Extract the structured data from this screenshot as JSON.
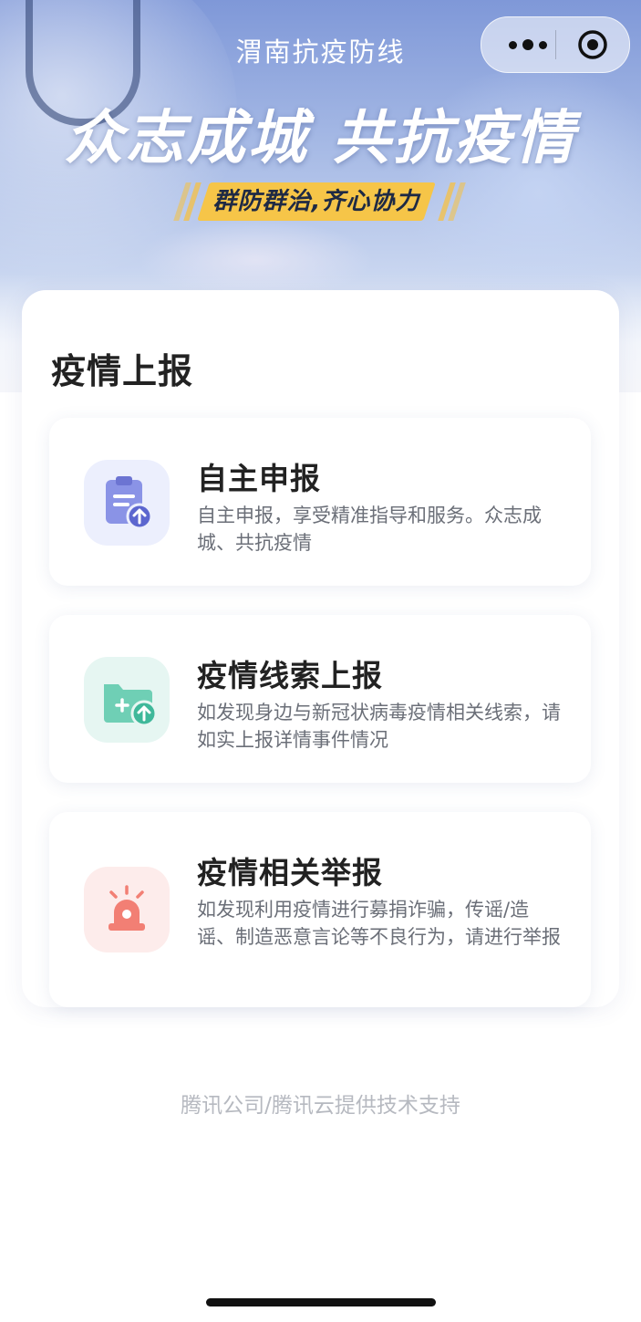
{
  "nav": {
    "title": "渭南抗疫防线"
  },
  "hero": {
    "slogan": "众志成城 共抗疫情",
    "banner": "群防群治,齐心协力"
  },
  "section": {
    "title": "疫情上报"
  },
  "items": [
    {
      "title": "自主申报",
      "desc": "自主申报，享受精准指导和服务。众志成城、共抗疫情",
      "icon": "clipboard-upload-icon",
      "icon_bg": "#eceffd",
      "icon_color": "#7d86e0"
    },
    {
      "title": "疫情线索上报",
      "desc": "如发现身边与新冠状病毒疫情相关线索，请如实上报详情事件情况",
      "icon": "folder-upload-icon",
      "icon_bg": "#e6f6f2",
      "icon_color": "#5cc6ac"
    },
    {
      "title": "疫情相关举报",
      "desc": "如发现利用疫情进行募捐诈骗，传谣/造谣、制造恶意言论等不良行为，请进行举报",
      "icon": "alarm-siren-icon",
      "icon_bg": "#fdeceb",
      "icon_color": "#f08178"
    }
  ],
  "footer": {
    "text": "腾讯公司/腾讯云提供技术支持"
  },
  "colors": {
    "banner": "#f6c548",
    "title_text": "#222222"
  }
}
